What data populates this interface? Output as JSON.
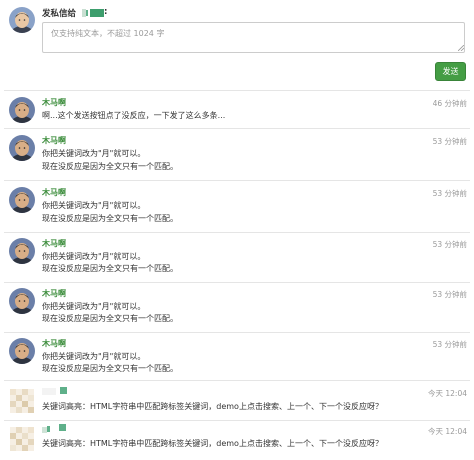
{
  "compose": {
    "title": "发私信给",
    "placeholder": "仅支持纯文本，不超过 1024 字",
    "send_label": "发送"
  },
  "messages": [
    {
      "user": "木马啊",
      "time": "46 分钟前",
      "lines": [
        "啊...这个发送按钮点了没反应，一下发了这么多条..."
      ]
    },
    {
      "user": "木马啊",
      "time": "53 分钟前",
      "lines": [
        "你把关键词改为\"月\"就可以。",
        "现在没反应是因为全文只有一个匹配。"
      ]
    },
    {
      "user": "木马啊",
      "time": "53 分钟前",
      "lines": [
        "你把关键词改为\"月\"就可以。",
        "现在没反应是因为全文只有一个匹配。"
      ]
    },
    {
      "user": "木马啊",
      "time": "53 分钟前",
      "lines": [
        "你把关键词改为\"月\"就可以。",
        "现在没反应是因为全文只有一个匹配。"
      ]
    },
    {
      "user": "木马啊",
      "time": "53 分钟前",
      "lines": [
        "你把关键词改为\"月\"就可以。",
        "现在没反应是因为全文只有一个匹配。"
      ]
    },
    {
      "user": "木马啊",
      "time": "53 分钟前",
      "lines": [
        "你把关键词改为\"月\"就可以。",
        "现在没反应是因为全文只有一个匹配。"
      ]
    },
    {
      "user": "",
      "time": "今天 12:04",
      "lines": [
        "关键词高亮：HTML字符串中匹配跨标签关键词，demo上点击搜索、上一个、下一个没反应呀？"
      ]
    },
    {
      "user": "",
      "time": "今天 12:04",
      "lines": [
        "关键词高亮：HTML字符串中匹配跨标签关键词，demo上点击搜索、上一个、下一个没反应呀？"
      ]
    }
  ],
  "colors": {
    "accent": "#449d44",
    "username": "#3c8d3c",
    "divider": "#e5e5e5",
    "muted": "#9a9a9a",
    "redaction": "#3d9e6d"
  },
  "icons": {
    "resize": "resize-grip-icon"
  }
}
